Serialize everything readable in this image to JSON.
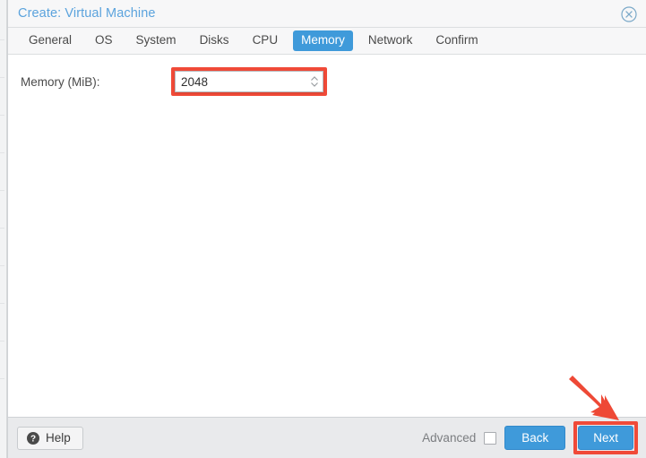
{
  "dialog": {
    "title": "Create: Virtual Machine",
    "close_icon": "close-circle-icon"
  },
  "tabs": [
    {
      "label": "General",
      "active": false
    },
    {
      "label": "OS",
      "active": false
    },
    {
      "label": "System",
      "active": false
    },
    {
      "label": "Disks",
      "active": false
    },
    {
      "label": "CPU",
      "active": false
    },
    {
      "label": "Memory",
      "active": true
    },
    {
      "label": "Network",
      "active": false
    },
    {
      "label": "Confirm",
      "active": false
    }
  ],
  "form": {
    "memory_label": "Memory (MiB):",
    "memory_value": "2048",
    "memory_placeholder": "",
    "spinner_icon": "spinner-updown-icon"
  },
  "footer": {
    "help_label": "Help",
    "help_icon": "question-circle-icon",
    "advanced_label": "Advanced",
    "advanced_checked": false,
    "back_label": "Back",
    "next_label": "Next"
  },
  "annotations": {
    "arrow_icon": "arrow-down-right-icon",
    "highlight_color": "#f04a38",
    "accent_color": "#3f9ada",
    "title_color": "#5ba3dd"
  }
}
